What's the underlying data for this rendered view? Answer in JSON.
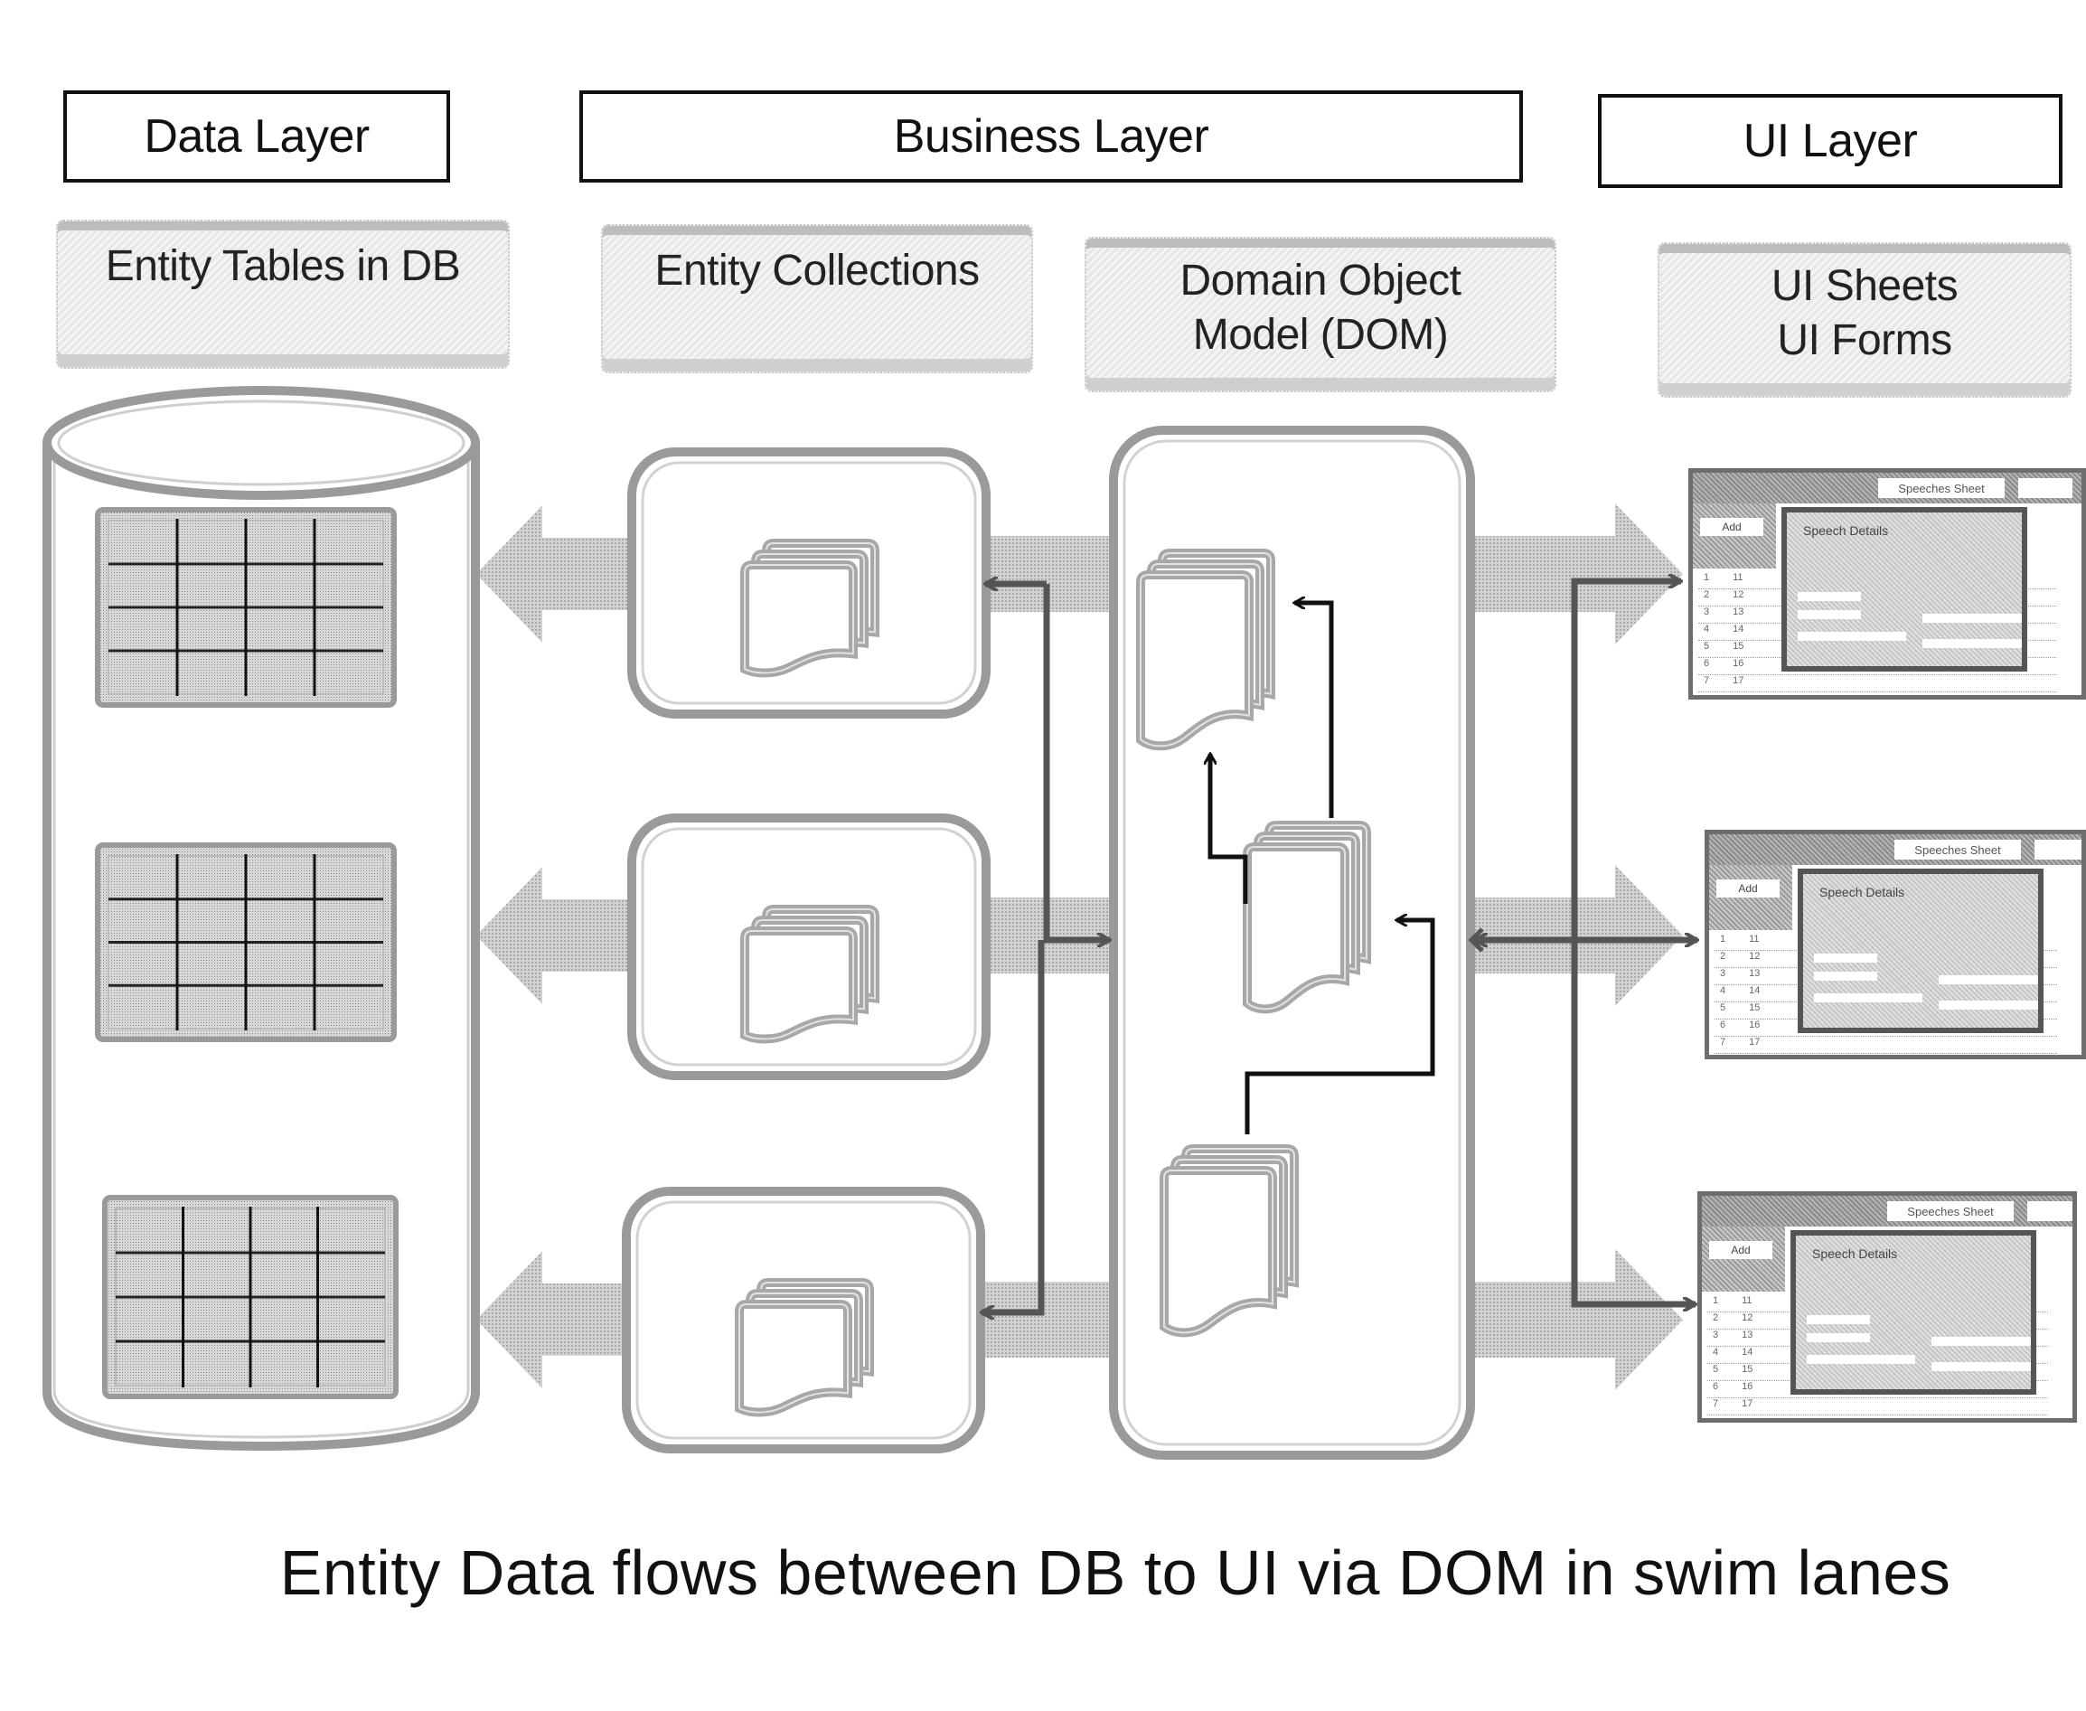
{
  "layers": {
    "data": "Data Layer",
    "business": "Business Layer",
    "ui": "UI Layer"
  },
  "labels": {
    "entity_tables": "Entity Tables in DB",
    "entity_collections": "Entity Collections",
    "dom_line1": "Domain Object",
    "dom_line2": "Model (DOM)",
    "ui_line1": "UI Sheets",
    "ui_line2": "UI Forms"
  },
  "database": {
    "icon": "database-cylinder-icon",
    "tables": [
      {
        "rows": 4,
        "cols": 4
      },
      {
        "rows": 4,
        "cols": 4
      },
      {
        "rows": 4,
        "cols": 4
      }
    ]
  },
  "collections": [
    {
      "icon": "document-stack-icon"
    },
    {
      "icon": "document-stack-icon"
    },
    {
      "icon": "document-stack-icon"
    }
  ],
  "dom_objects": [
    {
      "icon": "document-stack-icon"
    },
    {
      "icon": "document-stack-icon"
    },
    {
      "icon": "document-stack-icon"
    }
  ],
  "ui_screens": [
    {
      "tab_active": "Speeches Sheet",
      "button": "Add",
      "dialog_title": "Speech Details",
      "rows": [
        [
          "1",
          "11"
        ],
        [
          "2",
          "12"
        ],
        [
          "3",
          "13"
        ],
        [
          "4",
          "14"
        ],
        [
          "5",
          "15"
        ],
        [
          "6",
          "16"
        ],
        [
          "7",
          "17"
        ]
      ]
    },
    {
      "tab_active": "Speeches Sheet",
      "button": "Add",
      "dialog_title": "Speech Details",
      "rows": [
        [
          "1",
          "11"
        ],
        [
          "2",
          "12"
        ],
        [
          "3",
          "13"
        ],
        [
          "4",
          "14"
        ],
        [
          "5",
          "15"
        ],
        [
          "6",
          "16"
        ],
        [
          "7",
          "17"
        ]
      ]
    },
    {
      "tab_active": "Speeches Sheet",
      "button": "Add",
      "dialog_title": "Speech Details",
      "rows": [
        [
          "1",
          "11"
        ],
        [
          "2",
          "12"
        ],
        [
          "3",
          "13"
        ],
        [
          "4",
          "14"
        ],
        [
          "5",
          "15"
        ],
        [
          "6",
          "16"
        ],
        [
          "7",
          "17"
        ]
      ]
    }
  ],
  "caption": "Entity Data flows between DB to UI via DOM in swim lanes",
  "colors": {
    "line": "#111111",
    "arrow_fill": "#bdbdbd",
    "outline": "#8c8c8c",
    "table_fill": "#cfcfcf"
  }
}
